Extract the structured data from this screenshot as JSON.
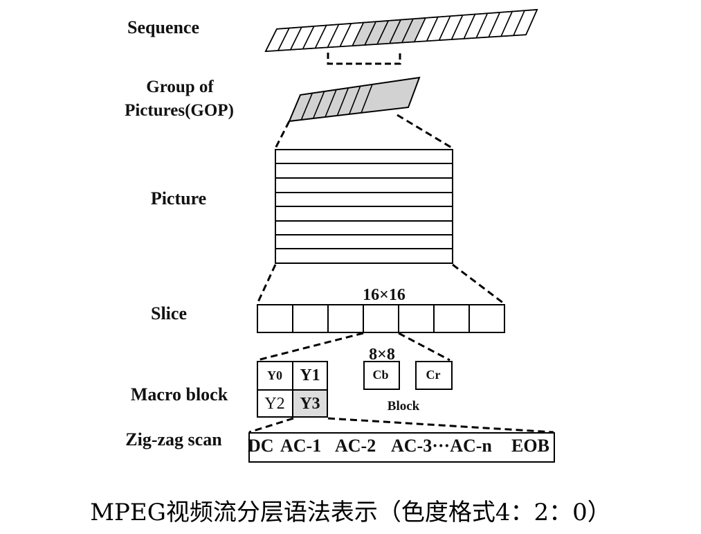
{
  "levels": {
    "sequence": "Sequence",
    "gop_line1": "Group of",
    "gop_line2": "Pictures(GOP)",
    "picture": "Picture",
    "slice": "Slice",
    "macroblock": "Macro block",
    "zigzag": "Zig-zag scan"
  },
  "slice_size": "16×16",
  "block_size": "8×8",
  "macroblock": {
    "luma": [
      "Y0",
      "Y1",
      "Y2",
      "Y3"
    ],
    "chroma": [
      "Cb",
      "Cr"
    ],
    "block_label": "Block"
  },
  "zigzag_items": [
    "DC",
    "AC-1",
    "AC-2",
    "AC-3···AC-n",
    "EOB"
  ],
  "caption": "MPEG视频流分层语法表示（色度格式4：2：0）"
}
